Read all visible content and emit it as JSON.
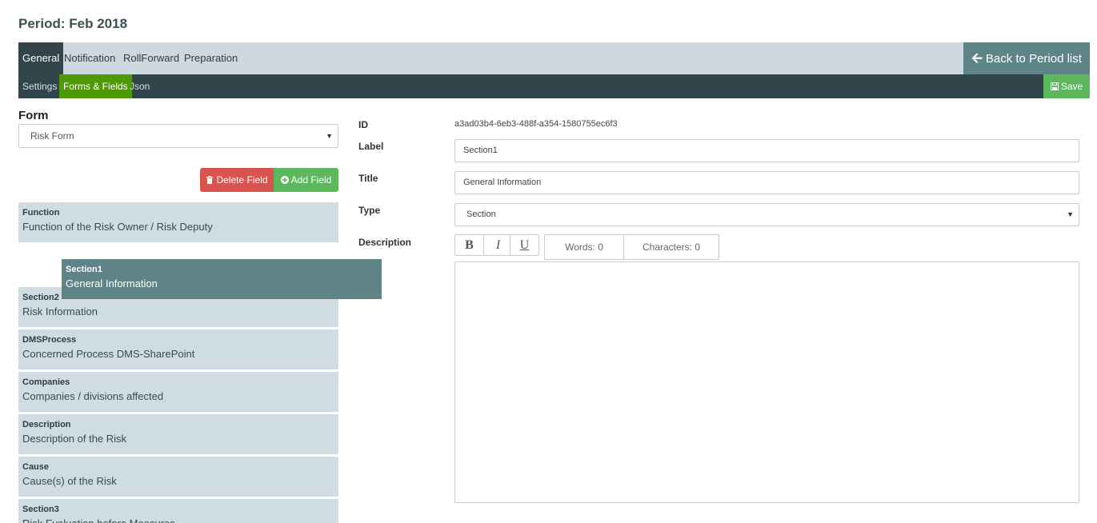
{
  "page": {
    "title": "Period: Feb 2018"
  },
  "nav": {
    "tabs": [
      "General",
      "Notification",
      "RollForward",
      "Preparation"
    ],
    "back_label": "Back to Period list",
    "subtabs": [
      "Settings",
      "Forms & Fields",
      "Json"
    ],
    "save_label": "Save"
  },
  "left": {
    "form_heading": "Form",
    "form_select_value": "Risk Form",
    "delete_label": "Delete Field",
    "add_label": "Add Field",
    "fields": [
      {
        "name": "Function",
        "label": "Function of the Risk Owner / Risk Deputy"
      },
      {
        "name": "Section2",
        "label": "Risk Information"
      },
      {
        "name": "DMSProcess",
        "label": "Concerned Process DMS-SharePoint"
      },
      {
        "name": "Companies",
        "label": "Companies / divisions affected"
      },
      {
        "name": "Description",
        "label": "Description of the Risk"
      },
      {
        "name": "Cause",
        "label": "Cause(s) of the Risk"
      },
      {
        "name": "Section3",
        "label": "Risk Evaluation before Measures"
      }
    ],
    "dragging": {
      "name": "Section1",
      "label": "General Information"
    }
  },
  "right": {
    "id_label": "ID",
    "id_value": "a3ad03b4-6eb3-488f-a354-1580755ec6f3",
    "label_label": "Label",
    "label_value": "Section1",
    "title_label": "Title",
    "title_value": "General Information",
    "type_label": "Type",
    "type_value": "Section",
    "description_label": "Description",
    "editor": {
      "bold": "B",
      "italic": "I",
      "underline": "U",
      "words": "Words: 0",
      "characters": "Characters: 0"
    }
  },
  "colors": {
    "nav_bg": "#cdd9de",
    "dark_bar": "#32454a",
    "active_green": "#4e9a06",
    "save_green": "#5cb85c",
    "delete_red": "#d9534f",
    "back_teal": "#5e8487",
    "field_bg": "#cfdde2"
  }
}
